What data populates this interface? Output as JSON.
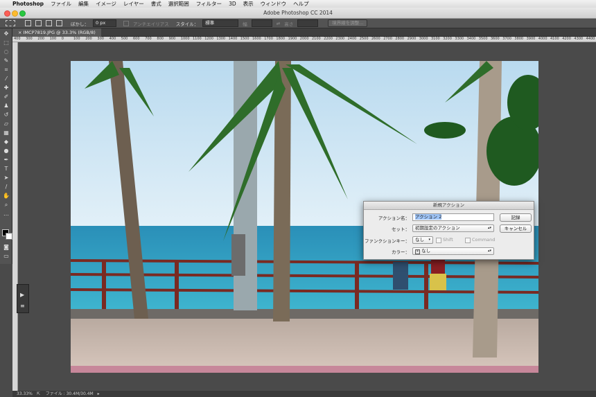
{
  "menubar": {
    "apple": "",
    "app": "Photoshop",
    "items": [
      "ファイル",
      "編集",
      "イメージ",
      "レイヤー",
      "書式",
      "選択範囲",
      "フィルター",
      "3D",
      "表示",
      "ウィンドウ",
      "ヘルプ"
    ]
  },
  "window": {
    "title": "Adobe Photoshop CC 2014"
  },
  "options": {
    "feather_label": "ぼかし：",
    "feather_value": "0 px",
    "antialias": "アンチエイリアス",
    "style_label": "スタイル：",
    "style_value": "標準",
    "width_label": "幅",
    "height_label": "高さ",
    "refine_button": "境界線を調整..."
  },
  "document": {
    "tab": "IMCP7819.JPG @ 33.3% (RGB/8)"
  },
  "ruler": {
    "ticks": [
      "400",
      "300",
      "200",
      "100",
      "0",
      "100",
      "200",
      "300",
      "400",
      "500",
      "600",
      "700",
      "800",
      "900",
      "1000",
      "1100",
      "1200",
      "1300",
      "1400",
      "1500",
      "1600",
      "1700",
      "1800",
      "1900",
      "2000",
      "2100",
      "2200",
      "2300",
      "2400",
      "2500",
      "2600",
      "2700",
      "2800",
      "2900",
      "3000",
      "3100",
      "3200",
      "3300",
      "3400",
      "3500",
      "3600",
      "3700",
      "3800",
      "3900",
      "4000",
      "4100",
      "4200",
      "4300",
      "4400"
    ]
  },
  "status": {
    "zoom": "33.33%",
    "file": "ファイル : 30.4M/30.4M"
  },
  "dialog": {
    "title": "新規アクション",
    "name_label": "アクション名：",
    "name_value": "アクション 2",
    "set_label": "セット：",
    "set_value": "初期設定のアクション",
    "fkey_label": "ファンクションキー：",
    "fkey_value": "なし",
    "shift": "Shift",
    "command": "Command",
    "color_label": "カラー：",
    "color_value": "なし",
    "record_button": "記録",
    "cancel_button": "キャンセル"
  },
  "colors": {
    "accent": "#9ec3f5",
    "sky": "#cfe6f4",
    "sea": "#2ea4c4"
  }
}
